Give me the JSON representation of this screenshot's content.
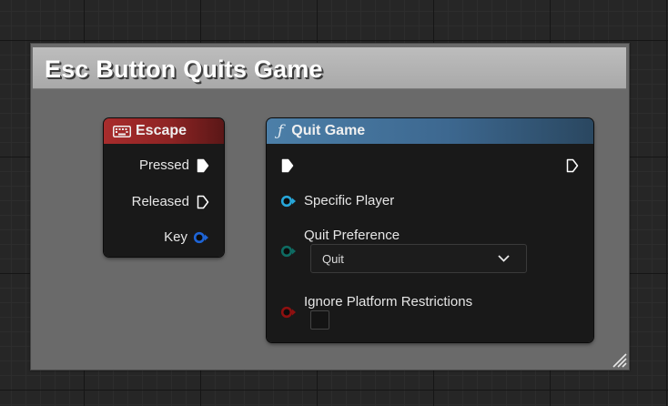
{
  "comment": {
    "title": "Esc Button Quits Game",
    "color": "#a9a9a9"
  },
  "escape_node": {
    "title": "Escape",
    "icon": "keyboard-icon",
    "header_color": "#8e2424",
    "pins": [
      {
        "label": "Pressed",
        "type": "exec",
        "connected": true
      },
      {
        "label": "Released",
        "type": "exec",
        "connected": false
      },
      {
        "label": "Key",
        "type": "struct",
        "color": "#1e64d6"
      }
    ]
  },
  "quit_node": {
    "title": "Quit Game",
    "icon": "function-icon",
    "header_color": "#3d6890",
    "inputs": [
      {
        "label": "Specific Player",
        "type": "object",
        "color": "#27a6d9"
      },
      {
        "label": "Quit Preference",
        "type": "enum",
        "color": "#0e6b62",
        "value": "Quit"
      },
      {
        "label": "Ignore Platform Restrictions",
        "type": "bool",
        "color": "#8e1010",
        "checked": false
      }
    ]
  }
}
